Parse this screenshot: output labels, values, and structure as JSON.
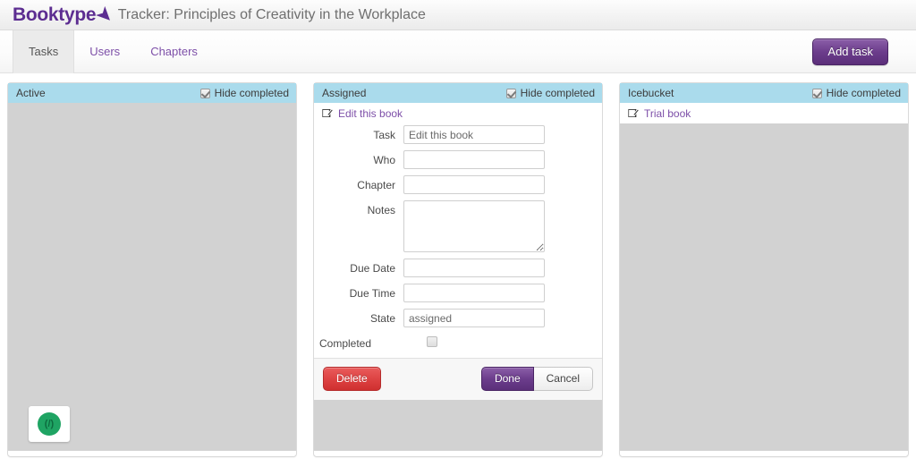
{
  "header": {
    "logo": "Booktype",
    "logo_arrow_icon": "arrow-chevron-icon",
    "title": "Tracker: Principles of Creativity in the Workplace",
    "brand_color": "#5c2d91"
  },
  "tabbar": {
    "tabs": [
      {
        "label": "Tasks",
        "active": true
      },
      {
        "label": "Users",
        "active": false
      },
      {
        "label": "Chapters",
        "active": false
      }
    ],
    "add_task_label": "Add task"
  },
  "columns": [
    {
      "title": "Active",
      "hide_completed_label": "Hide completed",
      "hide_completed_checked": true,
      "tasks": []
    },
    {
      "title": "Assigned",
      "hide_completed_label": "Hide completed",
      "hide_completed_checked": true,
      "tasks": [
        {
          "label": "Edit this book",
          "icon": "edit-icon"
        }
      ]
    },
    {
      "title": "Icebucket",
      "hide_completed_label": "Hide completed",
      "hide_completed_checked": true,
      "tasks": [
        {
          "label": "Trial book",
          "icon": "edit-icon"
        }
      ]
    }
  ],
  "edit_form": {
    "fields": {
      "task": {
        "label": "Task",
        "value": "Edit this book",
        "placeholder": ""
      },
      "who": {
        "label": "Who",
        "value": "",
        "placeholder": ""
      },
      "chapter": {
        "label": "Chapter",
        "value": "",
        "placeholder": ""
      },
      "notes": {
        "label": "Notes",
        "value": "",
        "placeholder": ""
      },
      "due_date": {
        "label": "Due Date",
        "value": "",
        "placeholder": ""
      },
      "due_time": {
        "label": "Due Time",
        "value": "",
        "placeholder": ""
      },
      "state": {
        "label": "State",
        "value": "assigned",
        "placeholder": ""
      },
      "completed": {
        "label": "Completed",
        "checked": false
      }
    },
    "buttons": {
      "delete": "Delete",
      "done": "Done",
      "cancel": "Cancel"
    },
    "colors": {
      "delete": "#dc4141",
      "done": "#6c3d8c"
    }
  },
  "status_badge": {
    "icon": "sync-status-icon",
    "color": "#1fa463"
  }
}
